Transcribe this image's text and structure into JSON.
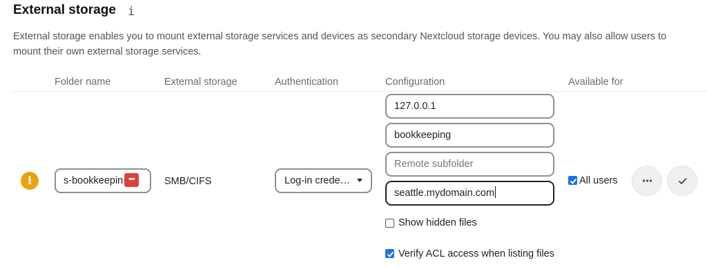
{
  "section": {
    "title": "External storage",
    "info_icon": "info-icon",
    "description": "External storage enables you to mount external storage services and devices as secondary Nextcloud storage devices. You may also allow users to mount their own external storage services."
  },
  "table": {
    "headers": {
      "folder_name": "Folder name",
      "external_storage": "External storage",
      "authentication": "Authentication",
      "configuration": "Configuration",
      "available_for": "Available for"
    },
    "row": {
      "status_icon": "info-icon",
      "folder_name_value": "s-bookkeepin",
      "password_manager_badge": "•••",
      "storage_type": "SMB/CIFS",
      "authentication_value": "Log-in crede…",
      "config": {
        "host": "127.0.0.1",
        "share": "bookkeeping",
        "remote_subfolder_placeholder": "Remote subfolder",
        "domain": "seattle.mydomain.com",
        "show_hidden_label": "Show hidden files",
        "show_hidden_checked": false,
        "verify_acl_label": "Verify ACL access when listing files",
        "verify_acl_checked": true
      },
      "available_for_label": "All users",
      "available_for_checked": true,
      "actions": {
        "more_icon": "more-horizontal-icon",
        "save_icon": "checkmark-icon"
      }
    }
  },
  "colors": {
    "accent": "#1a73e8",
    "warning": "#e9a30d",
    "badge_red": "#e0403b"
  }
}
